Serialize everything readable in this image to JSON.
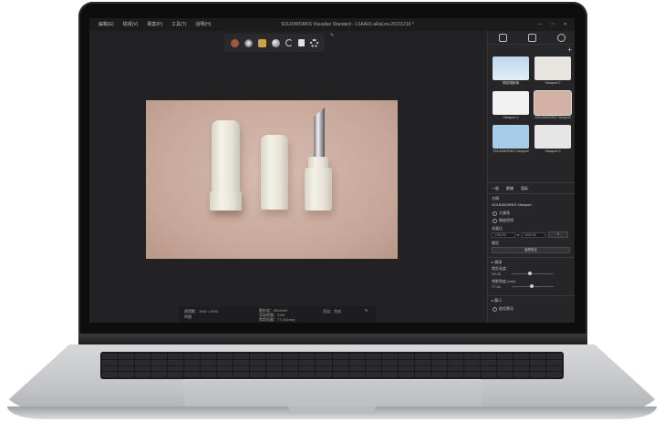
{
  "window": {
    "menu": [
      "編輯(E)",
      "檢視(V)",
      "專案(P)",
      "工具(T)",
      "說明(H)"
    ],
    "title": "SOLIDWORKS Visualize Standard - LSAA01-aRaLea-20211216 *",
    "controls": [
      "—",
      "□",
      "✕"
    ]
  },
  "toolbar": {
    "icons": [
      "material-icon",
      "environment-icon",
      "cube-icon",
      "sphere-icon",
      "rotate-icon",
      "save-icon",
      "gear-icon"
    ]
  },
  "status": {
    "left_top": "標還數：3000 / 3000",
    "left_bottom": "時間",
    "center_top": "解析度：850x540",
    "center_mid": "渲染時間：0:58",
    "center_bottom": "焦距距離：77.41(mm)",
    "right": "渲染：完成"
  },
  "panel": {
    "tabs": [
      "一般",
      "解譜",
      "面板"
    ],
    "viewports": [
      {
        "label": "預設攝影機"
      },
      {
        "label": "Viewport 2"
      },
      {
        "label": "Viewport 4"
      },
      {
        "label": "SOLIDWORKS Viewport"
      },
      {
        "label": "SOLIDWORKS Viewport"
      },
      {
        "label": "Viewport 3"
      }
    ],
    "section_name_label": "名稱",
    "section_name_value": "SOLIDWORKS Viewport",
    "option1": "大廣角",
    "option2": "開啟透視",
    "aspect_label": "長寬比",
    "aspect_w": "1700.00",
    "aspect_x": "x",
    "aspect_h": "1000.00",
    "aspect_dropdown": "▾",
    "type_label": "類型",
    "reset_button": "還原設定",
    "lens_section": "▸ 鏡頭",
    "focal_label": "焦距長度",
    "focal_value": "23.25",
    "fov_label": "視野角度 (mm)",
    "fov_value": "77.41",
    "display_section": "▸ 顯示",
    "display_option": "啟用景深"
  }
}
